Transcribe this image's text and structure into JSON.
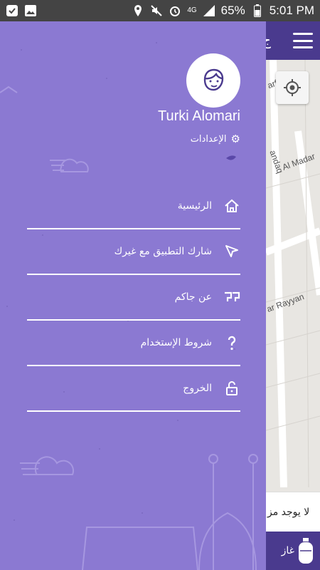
{
  "status_bar": {
    "battery": "65%",
    "time": "5:01 PM",
    "network": "4G"
  },
  "map": {
    "topbar_partial_text": "ج",
    "street_labels": [
      "Al Madar",
      "ar Rayyan",
      "andaq",
      "arfa"
    ],
    "bottom_banner_text": "لا يوجد مز",
    "bottom_bar_text": "غاز"
  },
  "drawer": {
    "user_name": "Turki Alomari",
    "settings_label": "الإعدادات",
    "menu": [
      {
        "label": "الرئيسية",
        "icon": "home-icon"
      },
      {
        "label": "شارك التطبيق مع غيرك",
        "icon": "send-icon"
      },
      {
        "label": "عن جاكم",
        "icon": "logo-icon"
      },
      {
        "label": "شروط الإستخدام",
        "icon": "question-icon"
      },
      {
        "label": "الخروج",
        "icon": "unlock-icon"
      }
    ]
  },
  "colors": {
    "drawer_bg": "#8b79d2",
    "header_bg": "#4a3a8e",
    "accent": "#4a3a8e"
  }
}
